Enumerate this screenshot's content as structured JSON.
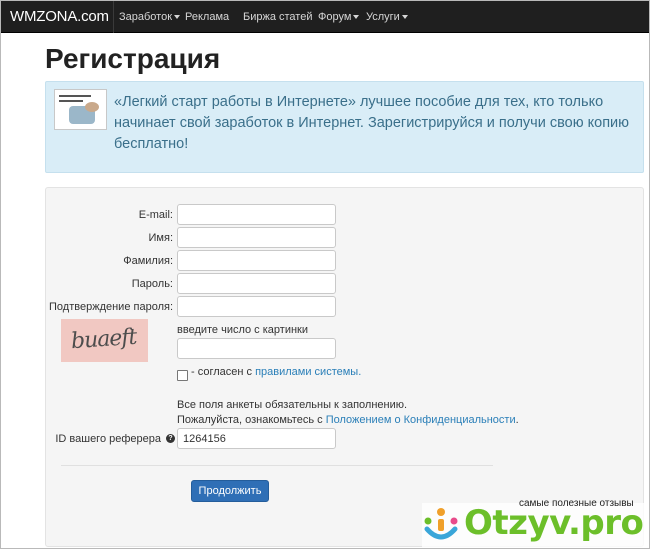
{
  "navbar": {
    "brand": "WMZONA.com",
    "items": [
      {
        "label": "Заработок",
        "dropdown": true
      },
      {
        "label": "Реклама",
        "dropdown": false
      },
      {
        "label": "Биржа статей",
        "dropdown": false
      },
      {
        "label": "Форум",
        "dropdown": true
      },
      {
        "label": "Услуги",
        "dropdown": true
      }
    ]
  },
  "page": {
    "title": "Регистрация"
  },
  "banner": {
    "text": "«Легкий старт работы в Интернете» лучшее пособие для тех, кто только начинает свой заработок в Интернет. Зарегистрируйся и получи свою копию бесплатно!",
    "book_icon": "book-cover-icon"
  },
  "form": {
    "fields": [
      {
        "label": "E-mail:",
        "value": ""
      },
      {
        "label": "Имя:",
        "value": ""
      },
      {
        "label": "Фамилия:",
        "value": ""
      },
      {
        "label": "Пароль:",
        "value": ""
      },
      {
        "label": "Подтверждение пароля:",
        "value": ""
      }
    ],
    "captcha": {
      "image_text": "buaeft",
      "prompt": "введите число с картинки",
      "value": ""
    },
    "agree": {
      "prefix": "- согласен с ",
      "link": "правилами системы.",
      "checked": false
    },
    "notice_line1": "Все поля анкеты обязательны к заполнению.",
    "notice_line2_prefix": "Пожалуйста, ознакомьтесь с ",
    "notice_line2_link": "Положением о Конфиденциальности",
    "notice_line2_suffix": ".",
    "referrer": {
      "label": "ID вашего реферера",
      "help_icon": "question-circle-icon",
      "value": "1264156"
    },
    "submit_label": "Продолжить"
  },
  "watermark": {
    "tagline": "самые полезные отзывы",
    "logo": "Otzyv.pro"
  },
  "colors": {
    "navbar_bg": "#1f1f1f",
    "banner_bg": "#d9edf7",
    "banner_text": "#3a6f8a",
    "link": "#2a7fb8",
    "button_bg": "#2f6fb6",
    "watermark_green": "#6cbf2a"
  }
}
